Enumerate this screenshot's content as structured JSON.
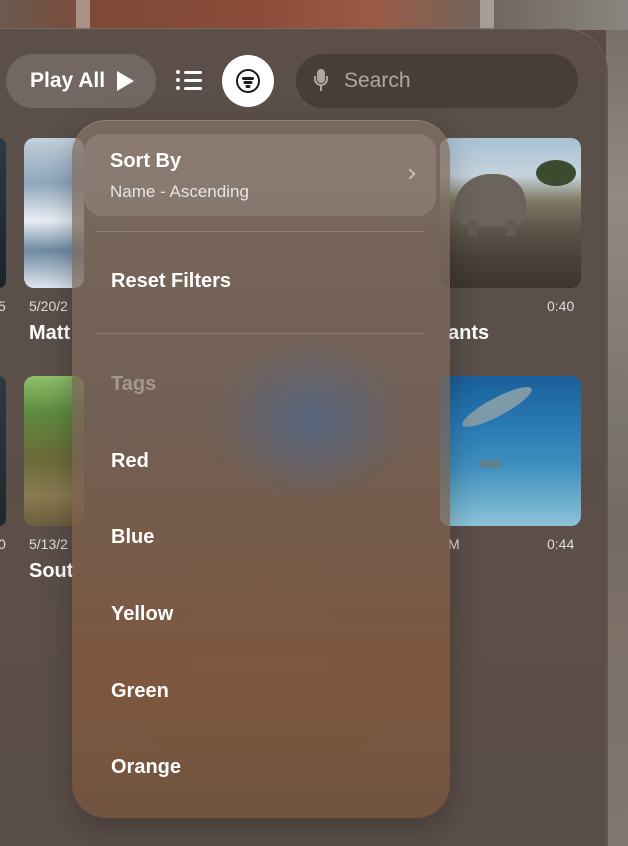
{
  "toolbar": {
    "play_all_label": "Play All",
    "search_placeholder": "Search",
    "list_view_icon": "list-icon",
    "filter_icon": "filter-icon",
    "mic_icon": "mic-icon"
  },
  "grid": {
    "row1": [
      {
        "date": "5",
        "title": ""
      },
      {
        "date": "5/20/2",
        "title": "Matt"
      },
      {
        "title": "ants",
        "duration": "0:40"
      }
    ],
    "row2": [
      {
        "date": "0",
        "title": ""
      },
      {
        "date": "5/13/2",
        "title": "Sout"
      },
      {
        "date": "M",
        "duration": "0:44"
      }
    ]
  },
  "menu": {
    "sort_by": {
      "label": "Sort By",
      "value": "Name - Ascending"
    },
    "reset_filters": "Reset Filters",
    "tags_header": "Tags",
    "tags": [
      "Red",
      "Blue",
      "Yellow",
      "Green",
      "Orange"
    ]
  }
}
